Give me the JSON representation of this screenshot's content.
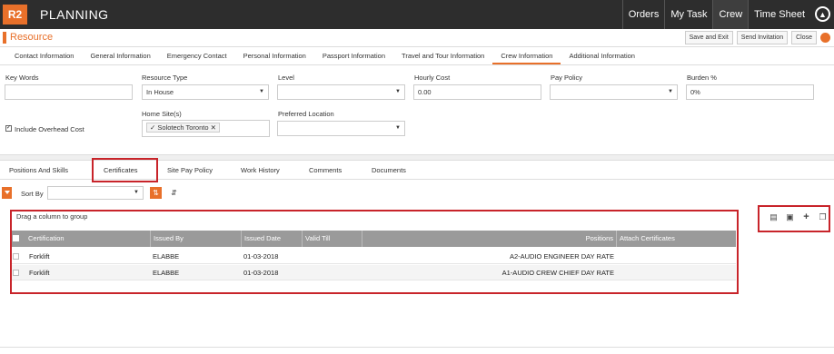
{
  "app": {
    "logo": "R2",
    "title": "PLANNING"
  },
  "topnav": [
    "Orders",
    "My Task",
    "Crew",
    "Time Sheet"
  ],
  "resource": {
    "title": "Resource",
    "actions": [
      "Save and Exit",
      "Send Invitation",
      "Close"
    ]
  },
  "main_tabs": [
    "Contact Information",
    "General Information",
    "Emergency Contact",
    "Personal Information",
    "Passport Information",
    "Travel and Tour Information",
    "Crew Information",
    "Additional Information"
  ],
  "form": {
    "keywords_label": "Key Words",
    "keywords_value": "",
    "resource_type_label": "Resource Type",
    "resource_type_value": "In House",
    "level_label": "Level",
    "level_value": "",
    "hourly_cost_label": "Hourly Cost",
    "hourly_cost_value": "0.00",
    "pay_policy_label": "Pay Policy",
    "pay_policy_value": "",
    "burden_label": "Burden %",
    "burden_value": "0%",
    "include_overhead_label": "Include Overhead Cost",
    "home_sites_label": "Home Site(s)",
    "home_site_tag": "Solotech Toronto",
    "preferred_location_label": "Preferred Location",
    "preferred_location_value": ""
  },
  "sub_tabs": [
    "Positions And Skills",
    "Certificates",
    "Site Pay Policy",
    "Work History",
    "Comments",
    "Documents"
  ],
  "toolbar": {
    "sort_by_label": "Sort By",
    "sort_by_value": ""
  },
  "grid": {
    "group_hint": "Drag a column to group",
    "columns": [
      "Certification",
      "Issued By",
      "Issued Date",
      "Valid Till",
      "Positions",
      "Attach Certificates"
    ],
    "rows": [
      {
        "certification": "Forklift",
        "issued_by": "ELABBE",
        "issued_date": "01-03-2018",
        "valid_till": "",
        "positions": "A2-AUDIO ENGINEER DAY RATE",
        "attach": ""
      },
      {
        "certification": "Forklift",
        "issued_by": "ELABBE",
        "issued_date": "01-03-2018",
        "valid_till": "",
        "positions": "A1-AUDIO CREW CHIEF DAY RATE",
        "attach": ""
      }
    ]
  },
  "colors": {
    "accent": "#e8702a",
    "topbar": "#2d2d2d",
    "highlight": "#c8242a",
    "grid_header": "#9a9a9a"
  },
  "icons": [
    "scroll-up-icon",
    "filter-icon",
    "sort-ascending-icon",
    "sort-alpha-icon",
    "export-icon",
    "save-icon",
    "add-icon",
    "copy-icon"
  ]
}
